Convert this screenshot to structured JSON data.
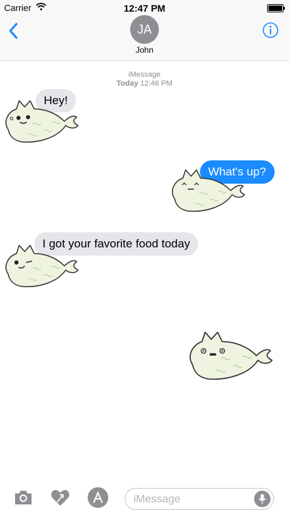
{
  "status_bar": {
    "carrier": "Carrier",
    "time": "12:47 PM"
  },
  "nav": {
    "avatar_initials": "JA",
    "contact_name": "John"
  },
  "thread_meta": {
    "service": "iMessage",
    "day": "Today",
    "time": "12:46 PM"
  },
  "messages": [
    {
      "direction": "incoming",
      "text": "Hey!",
      "sticker": "happy-cat-fish"
    },
    {
      "direction": "outgoing",
      "text": "What's up?",
      "sticker": "content-cat-fish"
    },
    {
      "direction": "incoming",
      "text": "I got your favorite food today",
      "sticker": "winking-cat-fish"
    },
    {
      "direction": "outgoing",
      "text": "",
      "sticker": "blank-stare-cat-fish"
    }
  ],
  "composer": {
    "placeholder": "iMessage"
  },
  "icons": {
    "back": "chevron-left-icon",
    "info": "info-icon",
    "camera": "camera-icon",
    "digital_touch": "heart-touch-icon",
    "app_store": "app-store-icon",
    "mic": "microphone-icon"
  },
  "colors": {
    "outgoing_bubble": "#1a8cff",
    "incoming_bubble": "#e5e5ea",
    "accent": "#1a8cff",
    "sticker_body": "#eef4e0"
  }
}
